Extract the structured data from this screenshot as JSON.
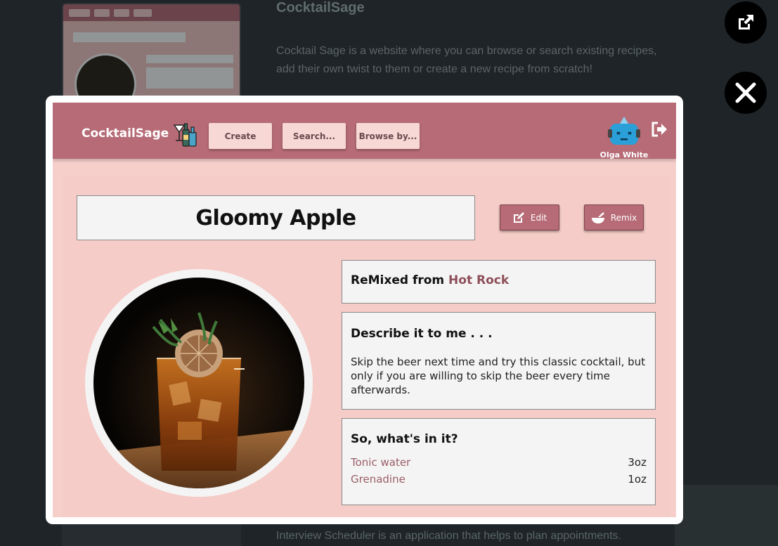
{
  "background": {
    "heading": "CocktailSage",
    "paragraph1": "Cocktail Sage is a website where you can browse or search existing recipes, add their own twist to them or create a new recipe from scratch!",
    "paragraph2": "Interview Scheduler is an application that helps to plan appointments. Depending"
  },
  "side_buttons": {
    "open_icon": "external-link-icon",
    "close_icon": "close-icon"
  },
  "navbar": {
    "brand": "CocktailSage",
    "brand_icon": "cocktail-bottles-icon",
    "buttons": [
      "Create",
      "Search...",
      "Browse by..."
    ],
    "user_name": "Olga White",
    "avatar_icon": "robot-avatar-icon",
    "logout_icon": "logout-icon"
  },
  "recipe": {
    "title": "Gloomy Apple",
    "edit_label": "Edit",
    "remix_label": "Remix",
    "remixed_prefix": "ReMixed from",
    "remixed_source": "Hot Rock",
    "describe_heading": "Describe it to me . . .",
    "description": "Skip the beer next time and try this classic cocktail, but only if you are willing to skip the beer every time afterwards.",
    "ingredients_heading": "So, what's in it?",
    "ingredients": [
      {
        "name": "Tonic water",
        "amount": "3oz"
      },
      {
        "name": "Grenadine",
        "amount": "1oz"
      }
    ]
  },
  "colors": {
    "navbar": "#b66b76",
    "content_bg": "#f5ccc7",
    "accent_text": "#8e4e59",
    "button_light": "#f7d8d4"
  }
}
